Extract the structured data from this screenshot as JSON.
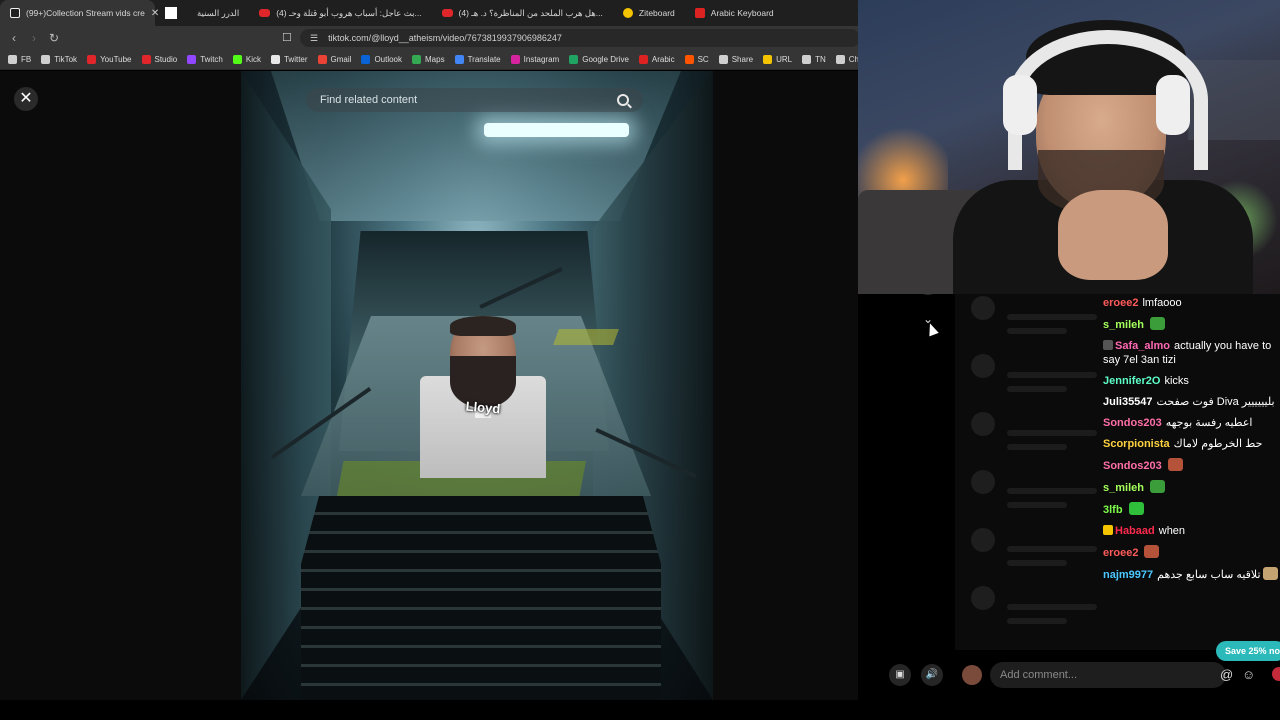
{
  "tabs": [
    {
      "label": "(99+)Collection Stream vids cre",
      "icon": "tiktok-icon",
      "active": true
    },
    {
      "label": "",
      "icon": "blank-page-icon",
      "active": false
    },
    {
      "label": "الدرر السنية",
      "icon": "",
      "active": false
    },
    {
      "label": "(4) بث عاجل: أسباب هروب أبو قتلة وحـ...",
      "icon": "youtube-icon",
      "active": false
    },
    {
      "label": "(4) هل هرب الملحد من المناظرة؟ د. هـ...",
      "icon": "youtube-icon",
      "active": false
    },
    {
      "label": "Ziteboard",
      "icon": "ziteboard-icon",
      "active": false
    },
    {
      "label": "Arabic Keyboard",
      "icon": "e-icon",
      "active": false
    }
  ],
  "url": "tiktok.com/@lloyd__atheism/video/7673819937906986247",
  "bookmarks": [
    "FB",
    "TikTok",
    "YouTube",
    "Studio",
    "Twitch",
    "Kick",
    "Twitter",
    "Gmail",
    "Outlook",
    "Maps",
    "Translate",
    "Instagram",
    "Google Drive",
    "Arabic",
    "SC",
    "Share",
    "URL",
    "TN",
    "Cha"
  ],
  "bookmark_colors": [
    "#cfcfcf",
    "#cfcfcf",
    "#e0262a",
    "#e0262a",
    "#9146ff",
    "#53fc18",
    "#e8e8e8",
    "#ea4335",
    "#0a64d8",
    "#34a853",
    "#4285f4",
    "#d6249f",
    "#1fa463",
    "#d22",
    "#ff5500",
    "#cfcfcf",
    "#f5c400",
    "#cfcfcf",
    "#cfcfcf"
  ],
  "video": {
    "search_placeholder": "Find related content",
    "overlay_label": "Lloyd"
  },
  "chat": {
    "messages": [
      {
        "user": "eroee2",
        "color": "#ff5a5a",
        "text": "lmfaooo",
        "emote": ""
      },
      {
        "user": "s_mileh",
        "color": "#a4ff5c",
        "text": "",
        "emote": "#3a9d3a"
      },
      {
        "user": "Safa_almo",
        "color": "#ff69b4",
        "text": "actually you have to say 7el 3an tizi",
        "emote": "",
        "badge": "#555"
      },
      {
        "user": "Jennifer2O",
        "color": "#5cffc8",
        "text": "kicks",
        "emote": ""
      },
      {
        "user": "Juli35547",
        "color": "#ffffff",
        "text": "فوت صفحت Diva بليييييير",
        "emote": ""
      },
      {
        "user": "Sondos203",
        "color": "#ff6fa8",
        "text": "اعطيه رفسة بوجهه",
        "emote": ""
      },
      {
        "user": "Scorpionista",
        "color": "#ffd23f",
        "text": "حط الخرطوم لاماك",
        "emote": ""
      },
      {
        "user": "Sondos203",
        "color": "#ff6fa8",
        "text": "",
        "emote": "#b5523a"
      },
      {
        "user": "s_mileh",
        "color": "#a4ff5c",
        "text": "",
        "emote": "#3a9d3a"
      },
      {
        "user": "3lfb",
        "color": "#7dff4a",
        "text": "",
        "emote": "#2fbf3a"
      },
      {
        "user": "Habaad",
        "color": "#ff2a4d",
        "text": "when",
        "emote": "",
        "badge": "#f5c400"
      },
      {
        "user": "eroee2",
        "color": "#ff5a5a",
        "text": "",
        "emote": "#b5523a"
      },
      {
        "user": "najm9977",
        "color": "#4ac8ff",
        "text": "تلاقيه ساب سابع جدهم",
        "emote": "#c4a572"
      }
    ],
    "comment_placeholder": "Add comment...",
    "promo": "Save 25% no"
  }
}
